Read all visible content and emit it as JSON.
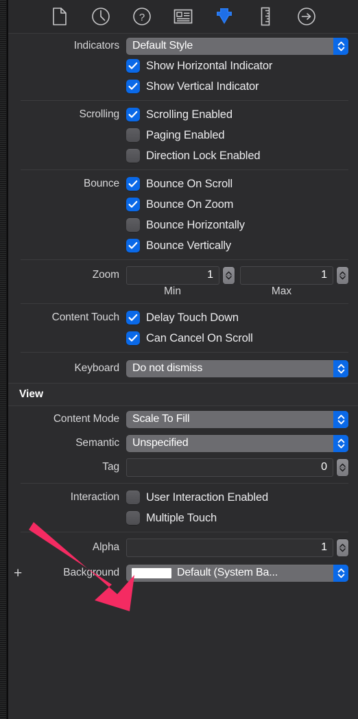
{
  "window": {
    "background_color": "#2c2c2e",
    "toolbar_color": "#29292b",
    "accent_color": "#0a69e8",
    "annotation_color": "#f42b62"
  },
  "toolbar": {
    "items": [
      {
        "icon": "file-document-icon",
        "label": "File Inspector",
        "selected": false
      },
      {
        "icon": "clock-history-icon",
        "label": "History Inspector",
        "selected": false
      },
      {
        "icon": "question-help-icon",
        "label": "Quick Help Inspector",
        "selected": false
      },
      {
        "icon": "identity-card-icon",
        "label": "Identity Inspector",
        "selected": false
      },
      {
        "icon": "attributes-arrow-icon",
        "label": "Attributes Inspector",
        "selected": true
      },
      {
        "icon": "ruler-size-icon",
        "label": "Size Inspector",
        "selected": false
      },
      {
        "icon": "connections-arrow-icon",
        "label": "Connections Inspector",
        "selected": false
      }
    ]
  },
  "sections": [
    {
      "name": "indicators",
      "rows": [
        {
          "type": "popup",
          "label": "Indicators",
          "name": "indicators-style-popup",
          "value": "Default Style"
        },
        {
          "type": "checkbox",
          "label": "",
          "name": "show-horizontal-indicator-checkbox",
          "text": "Show Horizontal Indicator",
          "checked": true
        },
        {
          "type": "checkbox",
          "label": "",
          "name": "show-vertical-indicator-checkbox",
          "text": "Show Vertical Indicator",
          "checked": true
        }
      ]
    },
    {
      "name": "scrolling",
      "rows": [
        {
          "type": "checkbox",
          "label": "Scrolling",
          "name": "scrolling-enabled-checkbox",
          "text": "Scrolling Enabled",
          "checked": true
        },
        {
          "type": "checkbox",
          "label": "",
          "name": "paging-enabled-checkbox",
          "text": "Paging Enabled",
          "checked": false
        },
        {
          "type": "checkbox",
          "label": "",
          "name": "direction-lock-enabled-checkbox",
          "text": "Direction Lock Enabled",
          "checked": false
        }
      ]
    },
    {
      "name": "bounce",
      "rows": [
        {
          "type": "checkbox",
          "label": "Bounce",
          "name": "bounce-on-scroll-checkbox",
          "text": "Bounce On Scroll",
          "checked": true
        },
        {
          "type": "checkbox",
          "label": "",
          "name": "bounce-on-zoom-checkbox",
          "text": "Bounce On Zoom",
          "checked": true
        },
        {
          "type": "checkbox",
          "label": "",
          "name": "bounce-horizontally-checkbox",
          "text": "Bounce Horizontally",
          "checked": false
        },
        {
          "type": "checkbox",
          "label": "",
          "name": "bounce-vertically-checkbox",
          "text": "Bounce Vertically",
          "checked": true
        }
      ]
    },
    {
      "name": "zoom",
      "label": "Zoom",
      "min_value": "1",
      "max_value": "1",
      "min_caption": "Min",
      "max_caption": "Max"
    },
    {
      "name": "content-touch",
      "rows": [
        {
          "type": "checkbox",
          "label": "Content Touch",
          "name": "delay-touch-down-checkbox",
          "text": "Delay Touch Down",
          "checked": true
        },
        {
          "type": "checkbox",
          "label": "",
          "name": "can-cancel-on-scroll-checkbox",
          "text": "Can Cancel On Scroll",
          "checked": true
        }
      ]
    },
    {
      "name": "keyboard",
      "rows": [
        {
          "type": "popup",
          "label": "Keyboard",
          "name": "keyboard-dismiss-mode-popup",
          "value": "Do not dismiss"
        }
      ]
    }
  ],
  "view_group": {
    "title": "View",
    "content_mode": {
      "label": "Content Mode",
      "value": "Scale To Fill"
    },
    "semantic": {
      "label": "Semantic",
      "value": "Unspecified"
    },
    "tag": {
      "label": "Tag",
      "value": "0"
    },
    "interaction": {
      "label": "Interaction",
      "user_interaction_enabled": {
        "text": "User Interaction Enabled",
        "checked": false
      },
      "multiple_touch": {
        "text": "Multiple Touch",
        "checked": false
      }
    },
    "alpha": {
      "label": "Alpha",
      "value": "1"
    },
    "background": {
      "label": "Background",
      "value": "Default (System Ba...",
      "swatch_color": "#ffffff",
      "add_label": "+"
    }
  }
}
